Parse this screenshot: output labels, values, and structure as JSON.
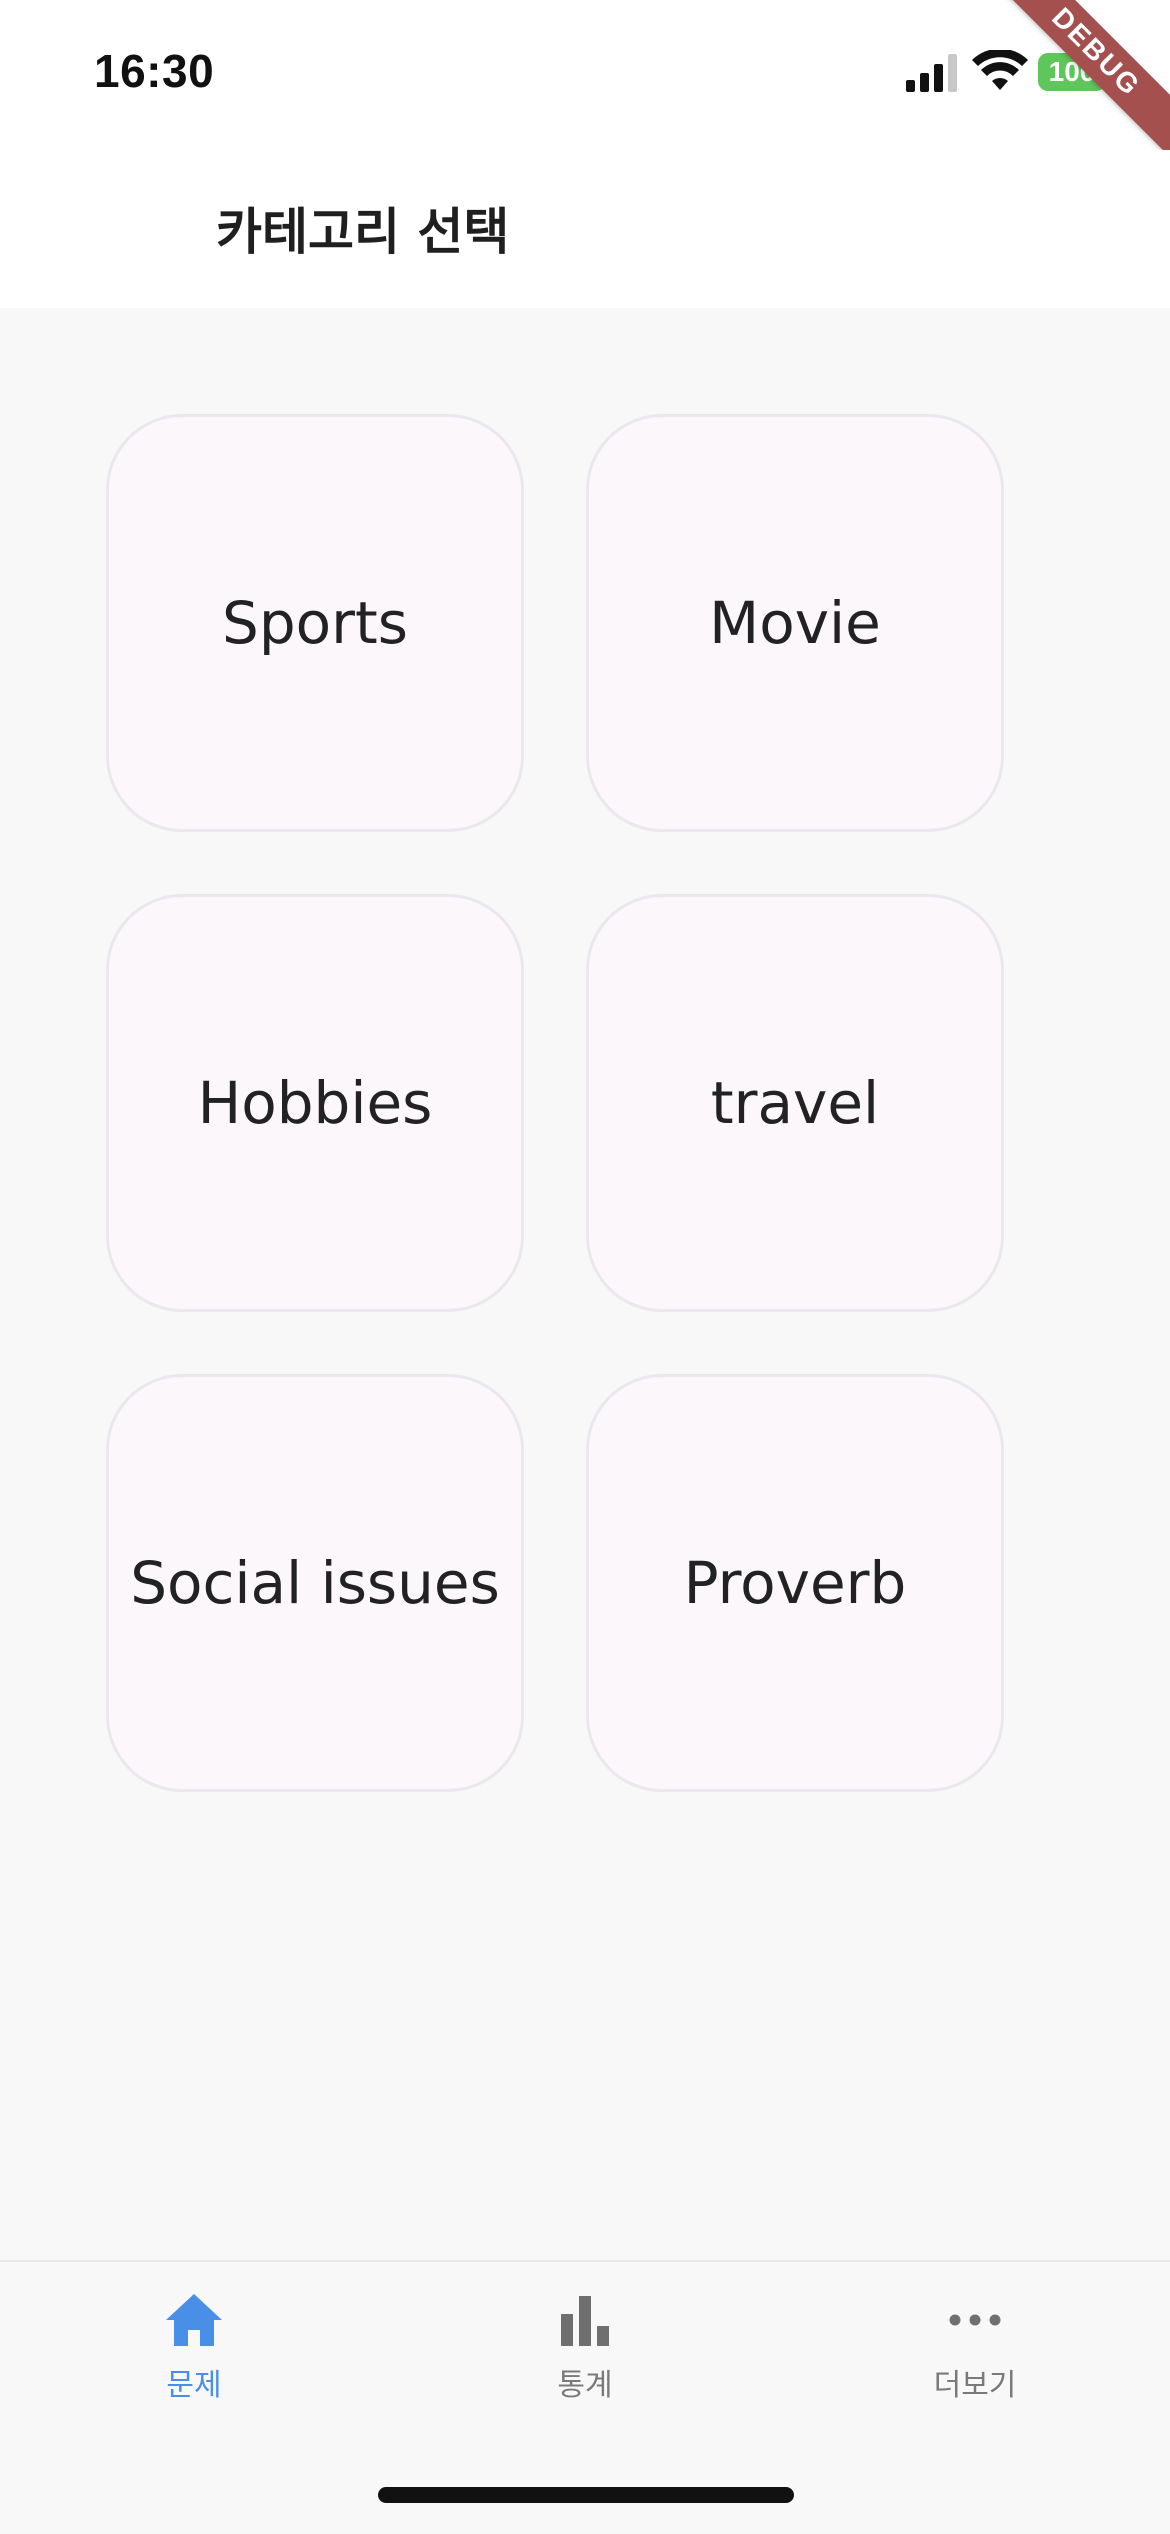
{
  "status_bar": {
    "time": "16:30",
    "battery": "100",
    "debug_label": "DEBUG"
  },
  "header": {
    "title": "카테고리 선택"
  },
  "categories": [
    {
      "label": "Sports"
    },
    {
      "label": "Movie"
    },
    {
      "label": "Hobbies"
    },
    {
      "label": "travel"
    },
    {
      "label": "Social issues"
    },
    {
      "label": "Proverb"
    }
  ],
  "bottom_nav": {
    "items": [
      {
        "label": "문제",
        "icon": "home-icon",
        "active": true
      },
      {
        "label": "통계",
        "icon": "bar-chart-icon",
        "active": false
      },
      {
        "label": "더보기",
        "icon": "more-icon",
        "active": false
      }
    ]
  },
  "colors": {
    "accent": "#4a8fe7",
    "card_bg": "#fbf7fb",
    "card_border": "#ebe7ee",
    "battery": "#5fc65b",
    "debug_ribbon": "#a3504f"
  }
}
